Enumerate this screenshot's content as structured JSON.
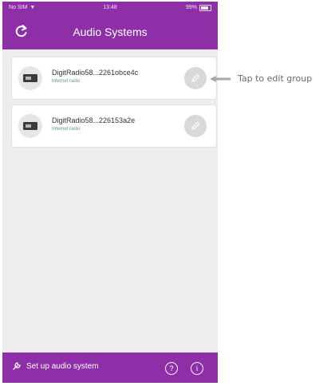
{
  "status_bar": {
    "carrier": "No SIM",
    "time": "13:48",
    "battery": "99%"
  },
  "header": {
    "title": "Audio Systems",
    "refresh_icon": "refresh-icon"
  },
  "devices": [
    {
      "name": "DigitRadio58...2261obce4c",
      "type": "Internet radio",
      "edit_icon": "pencil-icon"
    },
    {
      "name": "DigitRadio58...226153a2e",
      "type": "Internet radio",
      "edit_icon": "pencil-icon"
    }
  ],
  "annotation": {
    "text": "Tap to edit group"
  },
  "footer": {
    "setup_label": "Set up audio system",
    "help_label": "?",
    "info_label": "i"
  },
  "colors": {
    "accent": "#8f2fa8",
    "background": "#ededed",
    "device_type": "#4fa86d"
  }
}
